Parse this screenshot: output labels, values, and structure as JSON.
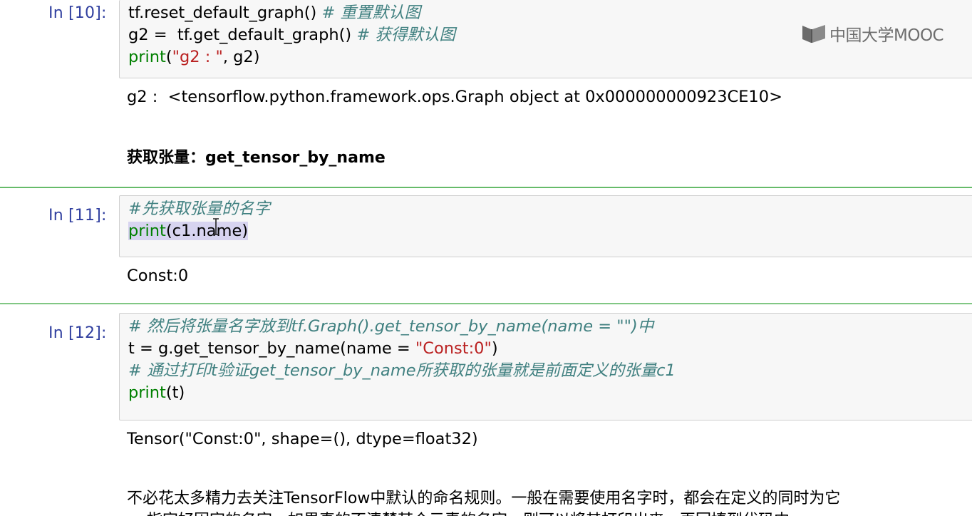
{
  "watermark": {
    "icon": "mooc-book-icon",
    "text": "中国大学MOOC"
  },
  "cells": [
    {
      "prompt": "In [10]:",
      "lines": [
        [
          {
            "t": "tf.reset_default_graph() ",
            "c": "plain"
          },
          {
            "t": "# 重置默认图",
            "c": "comment"
          }
        ],
        [
          {
            "t": "g2 =  tf.get_default_graph() ",
            "c": "plain"
          },
          {
            "t": "# 获得默认图",
            "c": "comment"
          }
        ],
        [
          {
            "t": "print",
            "c": "builtin"
          },
          {
            "t": "(",
            "c": "plain"
          },
          {
            "t": "\"g2 : \"",
            "c": "string"
          },
          {
            "t": ", g2)",
            "c": "plain"
          }
        ]
      ],
      "output": "g2 :  <tensorflow.python.framework.ops.Graph object at 0x000000000923CE10>"
    },
    {
      "prompt": "In [11]:",
      "lines": [
        [
          {
            "t": "#先获取张量的名字",
            "c": "comment"
          }
        ],
        [
          {
            "t": "print",
            "c": "builtin",
            "sel": true
          },
          {
            "t": "(c1.name)",
            "c": "plain",
            "sel": true
          }
        ]
      ],
      "output": "Const:0"
    },
    {
      "prompt": "In [12]:",
      "lines": [
        [
          {
            "t": "# 然后将张量名字放到tf.Graph().get_tensor_by_name(name = \"\")中",
            "c": "comment"
          }
        ],
        [
          {
            "t": "t = g.get_tensor_by_name(name = ",
            "c": "plain"
          },
          {
            "t": "\"Const:0\"",
            "c": "string"
          },
          {
            "t": ")",
            "c": "plain"
          }
        ],
        [
          {
            "t": "# 通过打印t验证get_tensor_by_name所获取的张量就是前面定义的张量c1",
            "c": "comment"
          }
        ],
        [
          {
            "t": "print",
            "c": "builtin"
          },
          {
            "t": "(t)",
            "c": "plain"
          }
        ]
      ],
      "output": "Tensor(\"Const:0\", shape=(), dtype=float32)"
    }
  ],
  "markdown": {
    "heading": "获取张量：get_tensor_by_name",
    "paragraph": "不必花太多精力去关注TensorFlow中默认的命名规则。一般在需要使用名字时，都会在定义的同时为它",
    "paragraph_cont": "    指定好固定的名字，如果真的不清楚某个元素的名字，则可以将其打印出来，再回填到代码中。"
  }
}
